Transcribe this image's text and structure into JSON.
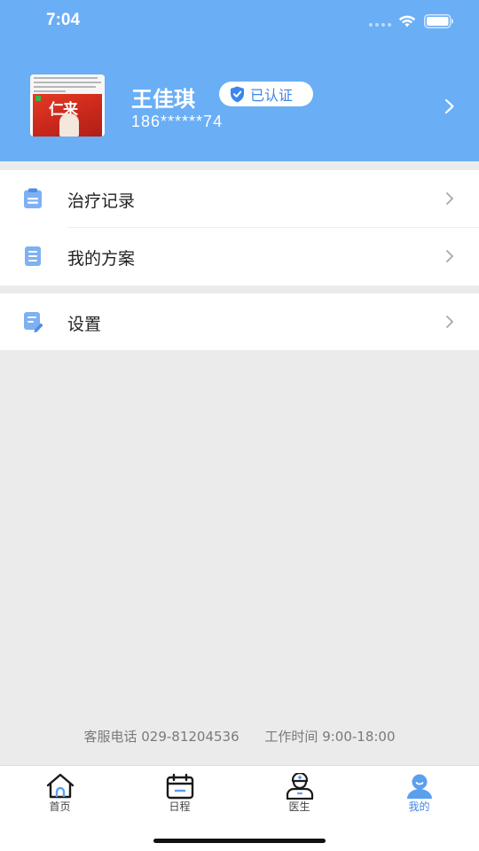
{
  "status_bar": {
    "time": "7:04"
  },
  "profile": {
    "name": "王佳琪",
    "verified_label": "已认证",
    "phone": "186******74",
    "avatar_text": "仁来"
  },
  "menu": {
    "group1": [
      {
        "label": "治疗记录",
        "icon": "clipboard-icon"
      },
      {
        "label": "我的方案",
        "icon": "document-list-icon"
      }
    ],
    "group2": [
      {
        "label": "设置",
        "icon": "edit-document-icon"
      }
    ]
  },
  "footer": {
    "hotline": "客服电话 029-81204536",
    "hours": "工作时间 9:00-18:00"
  },
  "tabs": [
    {
      "label": "首页",
      "icon": "home-icon",
      "active": false
    },
    {
      "label": "日程",
      "icon": "calendar-icon",
      "active": false
    },
    {
      "label": "医生",
      "icon": "doctor-icon",
      "active": false
    },
    {
      "label": "我的",
      "icon": "user-icon",
      "active": true
    }
  ],
  "colors": {
    "header_bg": "#6aaef5",
    "accent": "#3c86ea",
    "icon_blue": "#7eb1f2",
    "page_bg": "#ebebeb"
  }
}
